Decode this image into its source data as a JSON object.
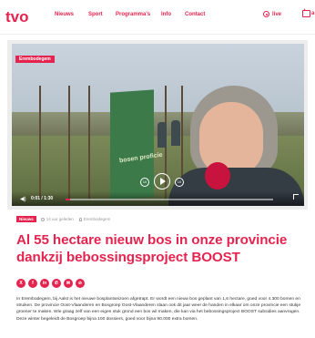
{
  "brand": {
    "logo_text": "tvo",
    "accent": "#e4244f"
  },
  "nav": {
    "items": [
      "Nieuws",
      "Sport",
      "Programma's",
      "Info",
      "Contact"
    ],
    "live_label": "live",
    "tv_icon": "tv-icon",
    "live_icon": "live-icon",
    "cut_off": "a"
  },
  "video": {
    "tag": "Erembodegem",
    "time": "0:01 / 1:30",
    "progress_fraction": 0.02,
    "banner_text": "bosen proficie",
    "mic_brand": "tvo",
    "skip_back": "10",
    "skip_forward": "10"
  },
  "article": {
    "category": "Nieuws",
    "published": "14 uur geleden",
    "location": "Erembodegem",
    "headline": "Al 55 hectare nieuw bos in onze provincie dankzij bebossingsproject BOOST",
    "share": [
      {
        "icon": "x-icon",
        "glyph": "X"
      },
      {
        "icon": "facebook-icon",
        "glyph": "f"
      },
      {
        "icon": "linkedin-icon",
        "glyph": "in"
      },
      {
        "icon": "whatsapp-icon",
        "glyph": "✆"
      },
      {
        "icon": "mail-icon",
        "glyph": "✉"
      },
      {
        "icon": "link-icon",
        "glyph": "⊘"
      }
    ],
    "lead": "In Erembodegem, bij Aalst is het nieuwe bosplantseizoen afgetrapt. Er wordt een nieuw bos geplant van 1,6 hectare, goed voor 4.300 bomen en struiken. De provincie Oost-Vlaanderen en Bosgroep Oost-Vlaanderen slaan ook dit jaar weer de handen in elkaar om onze provincie een stukje groener te maken. Wie graag zelf van een eigen stuk grond een bos wil maken, die kan via het bebossingsproject BOOST subsidies aanvragen. Deze winter begeleidt de Bosgroep bijna 100 dossiers, goed voor bijna 90.000 extra bomen."
  }
}
